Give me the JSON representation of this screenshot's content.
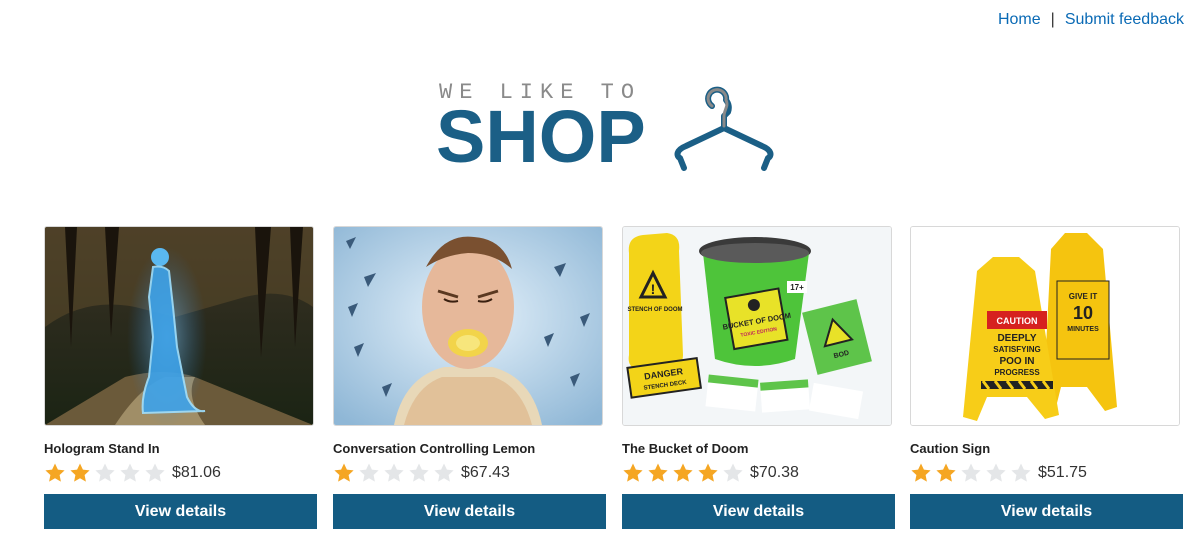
{
  "nav": {
    "home_label": "Home",
    "separator": "|",
    "feedback_label": "Submit feedback",
    "link_color": "#0a6ab5"
  },
  "logo": {
    "tagline": "WE LIKE TO",
    "word": "SHOP",
    "icon": "hanger-icon",
    "brand_color": "#1b5f86"
  },
  "products": [
    {
      "name": "Hologram Stand In",
      "rating": 2,
      "max_rating": 5,
      "price": "$81.06",
      "button_label": "View details",
      "image": "hologram-woman-image"
    },
    {
      "name": "Conversation Controlling Lemon",
      "rating": 1,
      "max_rating": 5,
      "price": "$67.43",
      "button_label": "View details",
      "image": "lemon-in-mouth-image"
    },
    {
      "name": "The Bucket of Doom",
      "rating": 4,
      "max_rating": 5,
      "price": "$70.38",
      "button_label": "View details",
      "image": "bucket-of-doom-image",
      "image_text": {
        "bucket_label": "BUCKET OF DOOM",
        "bucket_sub": "TOXIC EDITION",
        "bag_label": "STENCH OF DOOM",
        "box_label": "DANGER",
        "box_sub": "STENCH DECK",
        "card_label": "BOD",
        "lid_tag": "17+"
      }
    },
    {
      "name": "Caution Sign",
      "rating": 2,
      "max_rating": 5,
      "price": "$51.75",
      "button_label": "View details",
      "image": "caution-sign-image",
      "image_text": {
        "front_top": "CAUTION",
        "front_line1": "DEEPLY",
        "front_line2": "SATISFYING",
        "front_line3": "POO IN",
        "front_line4": "PROGRESS",
        "back_line1": "GIVE IT",
        "back_line2": "10",
        "back_line3": "MINUTES"
      }
    }
  ],
  "colors": {
    "star_filled": "#f5a623",
    "star_empty": "#e4e6e8",
    "button_bg": "#145c83"
  }
}
